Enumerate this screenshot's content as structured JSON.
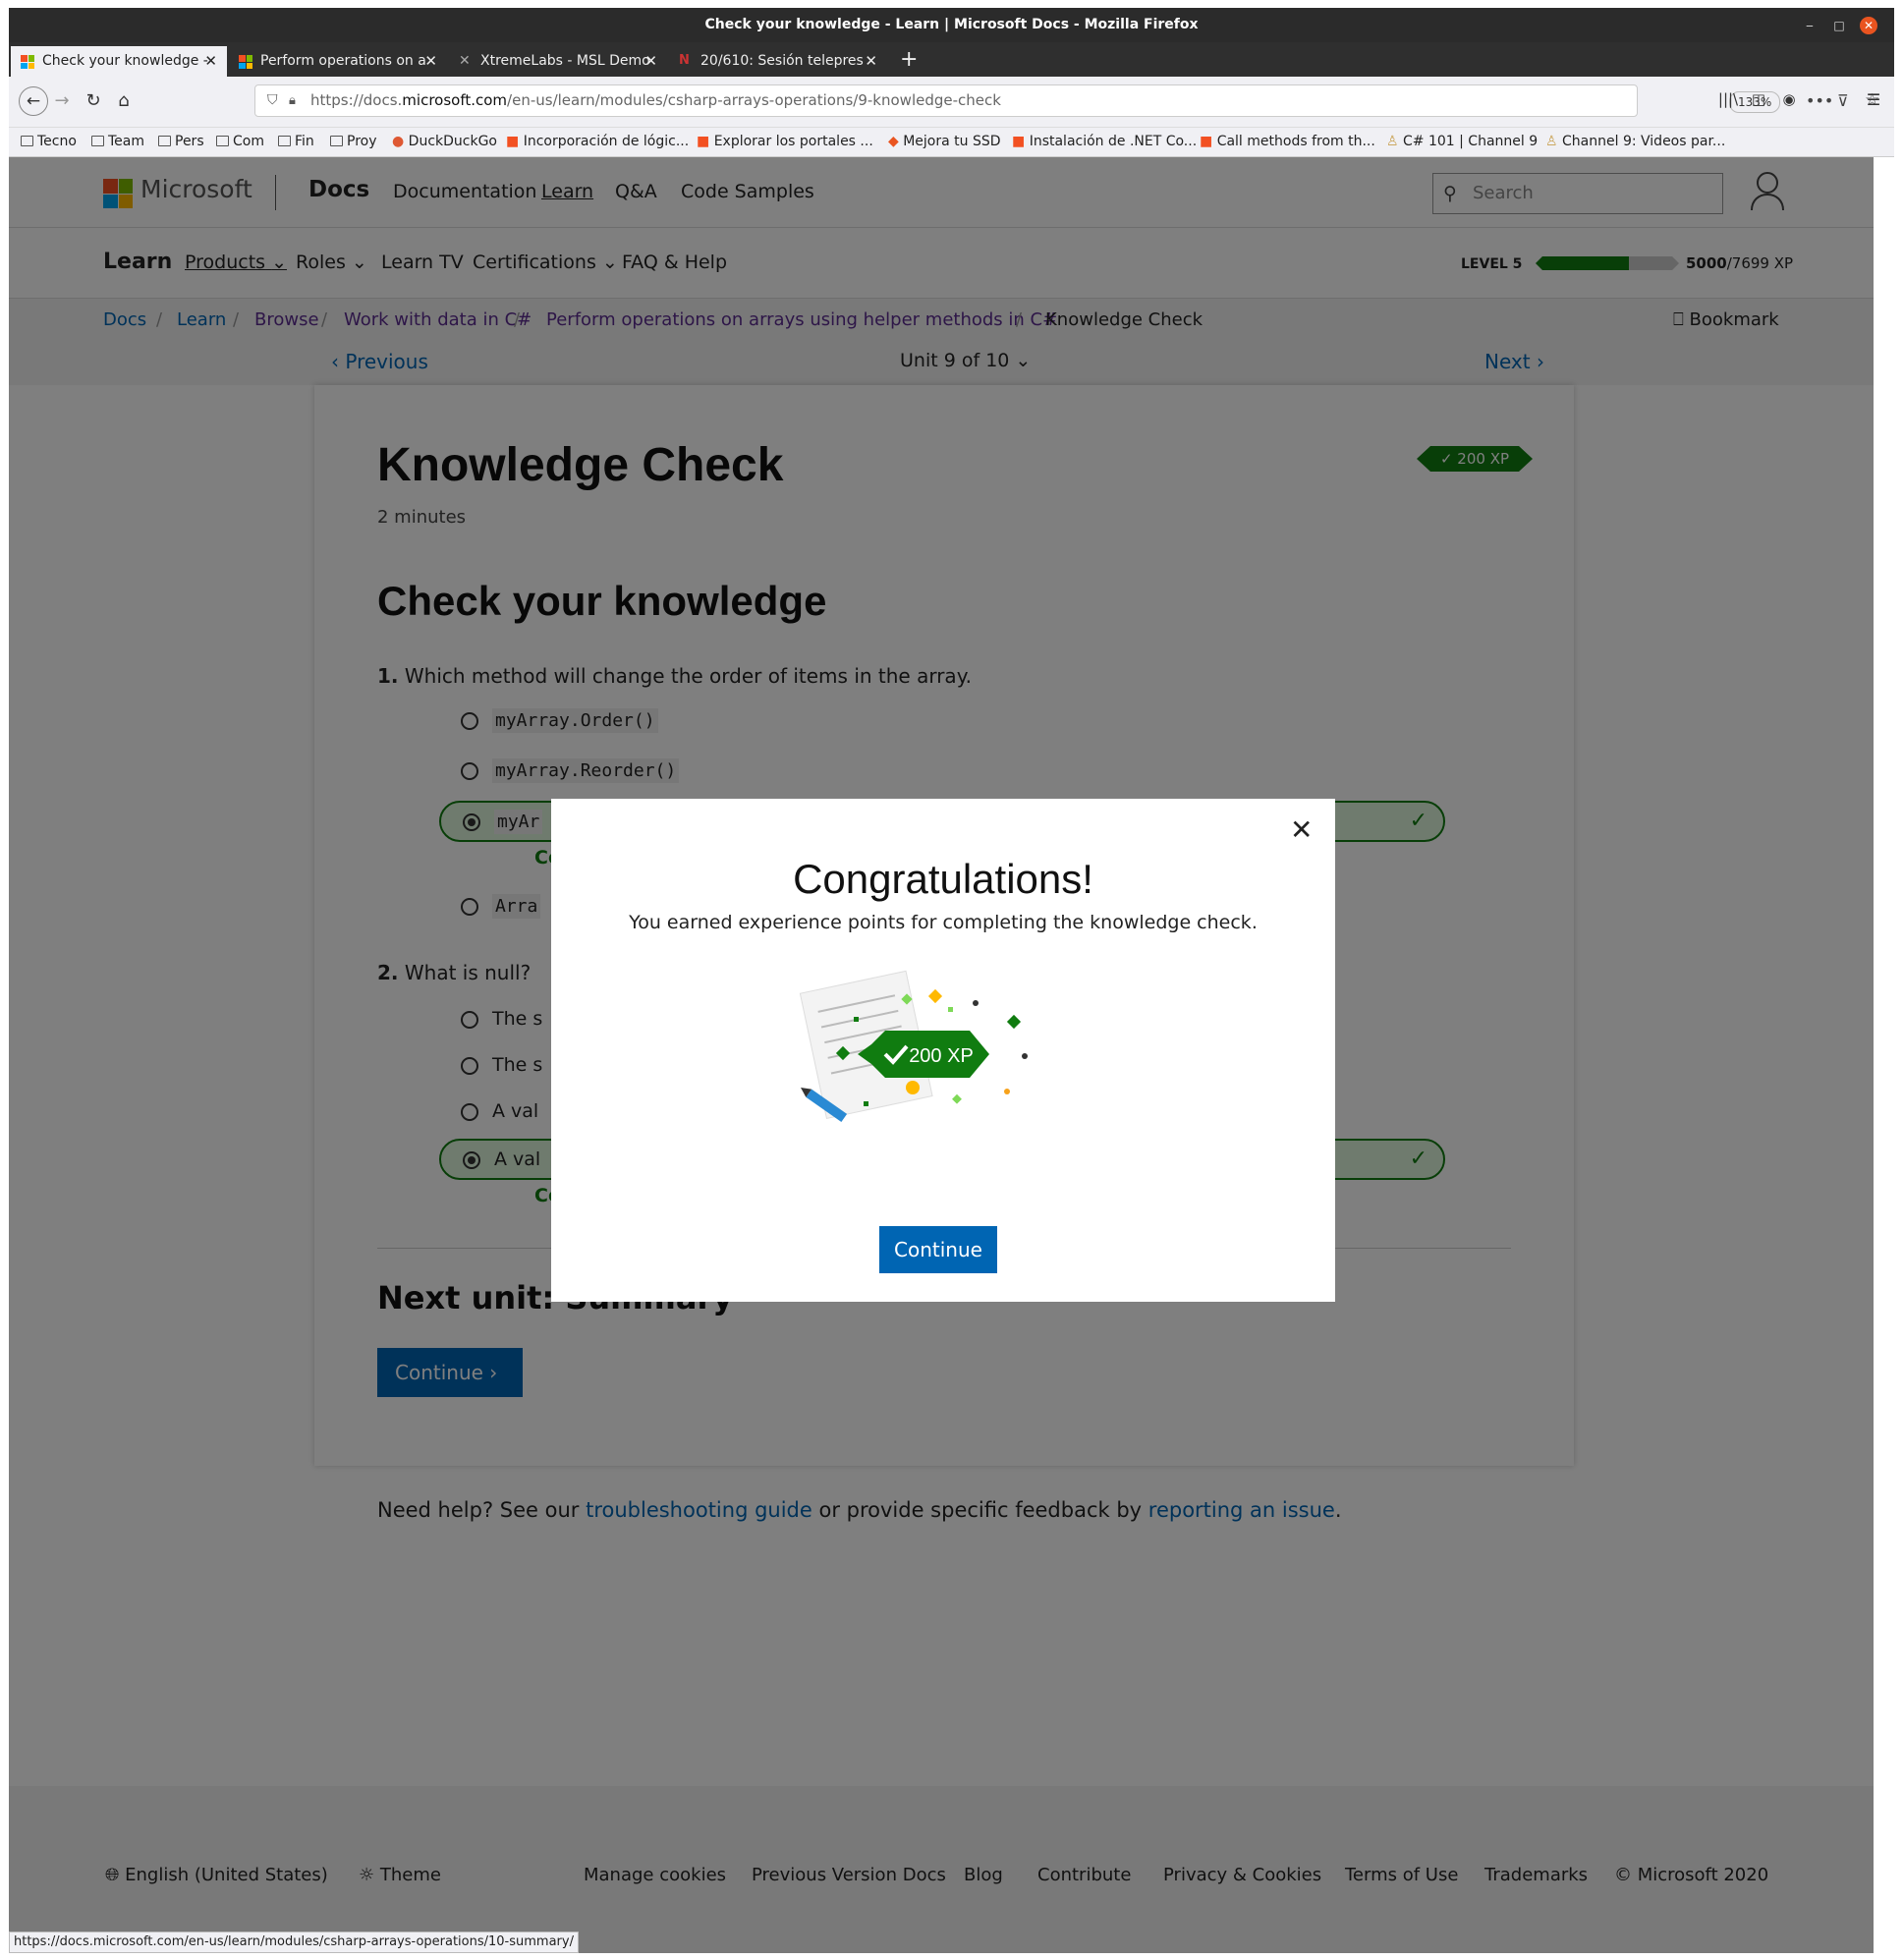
{
  "window": {
    "title": "Check your knowledge - Learn | Microsoft Docs - Mozilla Firefox"
  },
  "tabs": [
    {
      "label": "Check your knowledge -"
    },
    {
      "label": "Perform operations on a"
    },
    {
      "label": "XtremeLabs - MSL Demo"
    },
    {
      "label": "20/610: Sesión telepres"
    }
  ],
  "nav": {
    "url_prefix": "https://docs.",
    "url_domain": "microsoft.com",
    "url_path": "/en-us/learn/modules/csharp-arrays-operations/9-knowledge-check",
    "zoom": "133%"
  },
  "bookmarks": [
    "Tecno",
    "Team",
    "Pers",
    "Com",
    "Fin",
    "Proy",
    "DuckDuckGo",
    "Incorporación de lógic...",
    "Explorar los portales ...",
    "Mejora tu SSD",
    "Instalación de .NET Co...",
    "Call methods from th...",
    "C# 101 | Channel 9",
    "Channel 9: Videos par..."
  ],
  "header": {
    "brand": "Microsoft",
    "product": "Docs",
    "links": [
      "Documentation",
      "Learn",
      "Q&A",
      "Code Samples"
    ],
    "search_placeholder": "Search"
  },
  "subnav": {
    "title": "Learn",
    "links": [
      "Products",
      "Roles",
      "Learn TV",
      "Certifications",
      "FAQ & Help"
    ],
    "level": "LEVEL 5",
    "xp_current": "5000",
    "xp_total": "/7699 XP",
    "progress": 0.65
  },
  "breadcrumb": [
    "Docs",
    "Learn",
    "Browse",
    "Work with data in C#",
    "Perform operations on arrays using helper methods in C#",
    "Knowledge Check"
  ],
  "bookmark_label": "Bookmark",
  "unitnav": {
    "previous": "Previous",
    "unit": "Unit 9 of 10",
    "next": "Next"
  },
  "content": {
    "title": "Knowledge Check",
    "duration": "2 minutes",
    "xp_badge": "200 XP",
    "heading": "Check your knowledge",
    "q1": {
      "num": "1.",
      "text": "Which method will change the order of items in the array.",
      "options": [
        "myArray.Order()",
        "myArray.Reorder()",
        "myAr",
        "Arra"
      ],
      "correct_label": "Co"
    },
    "q2": {
      "num": "2.",
      "text": "What is null?",
      "options": [
        "The s",
        "The s",
        "A val",
        "A val"
      ],
      "correct_label": "Co"
    },
    "next_unit": "Next unit: Summary",
    "continue": "Continue"
  },
  "help": {
    "prefix": "Need help? See our ",
    "link1": "troubleshooting guide",
    "middle": " or provide specific feedback by ",
    "link2": "reporting an issue",
    "suffix": "."
  },
  "footer": {
    "language": "English (United States)",
    "theme": "Theme",
    "links": [
      "Manage cookies",
      "Previous Version Docs",
      "Blog",
      "Contribute",
      "Privacy & Cookies",
      "Terms of Use",
      "Trademarks",
      "© Microsoft 2020"
    ]
  },
  "modal": {
    "title": "Congratulations!",
    "subtitle": "You earned experience points for completing the knowledge check.",
    "xp": "200 XP",
    "button": "Continue"
  },
  "status_url": "https://docs.microsoft.com/en-us/learn/modules/csharp-arrays-operations/10-summary/"
}
